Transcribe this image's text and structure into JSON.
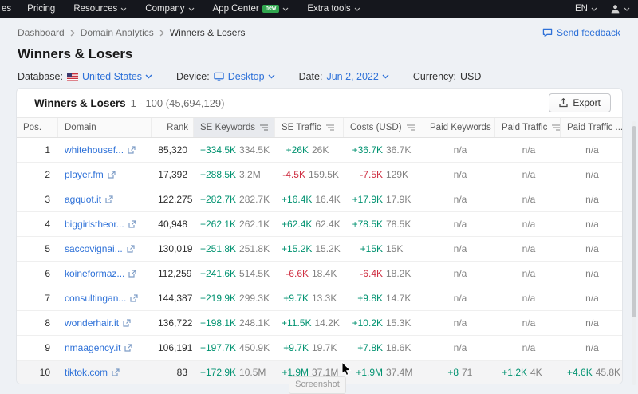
{
  "topnav": {
    "items": [
      {
        "label": "es"
      },
      {
        "label": "Pricing"
      },
      {
        "label": "Resources"
      },
      {
        "label": "Company"
      },
      {
        "label": "App Center",
        "badge": "new"
      },
      {
        "label": "Extra tools"
      }
    ],
    "lang": "EN"
  },
  "breadcrumb": {
    "items": [
      "Dashboard",
      "Domain Analytics",
      "Winners & Losers"
    ],
    "feedback_label": "Send feedback"
  },
  "page": {
    "title": "Winners & Losers"
  },
  "filters": {
    "database_label": "Database:",
    "database_value": "United States",
    "device_label": "Device:",
    "device_value": "Desktop",
    "date_label": "Date:",
    "date_value": "Jun 2, 2022",
    "currency_label": "Currency:",
    "currency_value": "USD"
  },
  "card": {
    "title": "Winners & Losers",
    "range": "1 - 100 (45,694,129)",
    "export_label": "Export"
  },
  "table": {
    "columns": [
      {
        "label": "Pos.",
        "sortable": false
      },
      {
        "label": "Domain",
        "sortable": false
      },
      {
        "label": "Rank",
        "sortable": false
      },
      {
        "label": "SE Keywords",
        "sortable": true,
        "sorted": true
      },
      {
        "label": "SE Traffic",
        "sortable": true
      },
      {
        "label": "Costs (USD)",
        "sortable": true
      },
      {
        "label": "Paid Keywords",
        "sortable": true
      },
      {
        "label": "Paid Traffic",
        "sortable": true
      },
      {
        "label": "Paid Traffic ...",
        "sortable": true
      }
    ],
    "rows": [
      {
        "pos": "1",
        "domain": "whitehousef...",
        "rank": "85,320",
        "cells": [
          {
            "delta": "+334.5K",
            "value": "334.5K",
            "dir": "up"
          },
          {
            "delta": "+26K",
            "value": "26K",
            "dir": "up"
          },
          {
            "delta": "+36.7K",
            "value": "36.7K",
            "dir": "up"
          },
          "n/a",
          "n/a",
          "n/a"
        ]
      },
      {
        "pos": "2",
        "domain": "player.fm",
        "rank": "17,392",
        "cells": [
          {
            "delta": "+288.5K",
            "value": "3.2M",
            "dir": "up"
          },
          {
            "delta": "-4.5K",
            "value": "159.5K",
            "dir": "down"
          },
          {
            "delta": "-7.5K",
            "value": "129K",
            "dir": "down"
          },
          "n/a",
          "n/a",
          "n/a"
        ]
      },
      {
        "pos": "3",
        "domain": "agquot.it",
        "rank": "122,275",
        "cells": [
          {
            "delta": "+282.7K",
            "value": "282.7K",
            "dir": "up"
          },
          {
            "delta": "+16.4K",
            "value": "16.4K",
            "dir": "up"
          },
          {
            "delta": "+17.9K",
            "value": "17.9K",
            "dir": "up"
          },
          "n/a",
          "n/a",
          "n/a"
        ]
      },
      {
        "pos": "4",
        "domain": "biggirlstheor...",
        "rank": "40,948",
        "cells": [
          {
            "delta": "+262.1K",
            "value": "262.1K",
            "dir": "up"
          },
          {
            "delta": "+62.4K",
            "value": "62.4K",
            "dir": "up"
          },
          {
            "delta": "+78.5K",
            "value": "78.5K",
            "dir": "up"
          },
          "n/a",
          "n/a",
          "n/a"
        ]
      },
      {
        "pos": "5",
        "domain": "saccovignai...",
        "rank": "130,019",
        "cells": [
          {
            "delta": "+251.8K",
            "value": "251.8K",
            "dir": "up"
          },
          {
            "delta": "+15.2K",
            "value": "15.2K",
            "dir": "up"
          },
          {
            "delta": "+15K",
            "value": "15K",
            "dir": "up"
          },
          "n/a",
          "n/a",
          "n/a"
        ]
      },
      {
        "pos": "6",
        "domain": "koineformaz...",
        "rank": "112,259",
        "cells": [
          {
            "delta": "+241.6K",
            "value": "514.5K",
            "dir": "up"
          },
          {
            "delta": "-6.6K",
            "value": "18.4K",
            "dir": "down"
          },
          {
            "delta": "-6.4K",
            "value": "18.2K",
            "dir": "down"
          },
          "n/a",
          "n/a",
          "n/a"
        ]
      },
      {
        "pos": "7",
        "domain": "consultingan...",
        "rank": "144,387",
        "cells": [
          {
            "delta": "+219.9K",
            "value": "299.3K",
            "dir": "up"
          },
          {
            "delta": "+9.7K",
            "value": "13.3K",
            "dir": "up"
          },
          {
            "delta": "+9.8K",
            "value": "14.7K",
            "dir": "up"
          },
          "n/a",
          "n/a",
          "n/a"
        ]
      },
      {
        "pos": "8",
        "domain": "wonderhair.it",
        "rank": "136,722",
        "cells": [
          {
            "delta": "+198.1K",
            "value": "248.1K",
            "dir": "up"
          },
          {
            "delta": "+11.5K",
            "value": "14.2K",
            "dir": "up"
          },
          {
            "delta": "+10.2K",
            "value": "15.3K",
            "dir": "up"
          },
          "n/a",
          "n/a",
          "n/a"
        ]
      },
      {
        "pos": "9",
        "domain": "nmaagency.it",
        "rank": "106,191",
        "cells": [
          {
            "delta": "+197.7K",
            "value": "450.9K",
            "dir": "up"
          },
          {
            "delta": "+9.7K",
            "value": "19.7K",
            "dir": "up"
          },
          {
            "delta": "+7.8K",
            "value": "18.6K",
            "dir": "up"
          },
          "n/a",
          "n/a",
          "n/a"
        ]
      },
      {
        "pos": "10",
        "domain": "tiktok.com",
        "rank": "83",
        "highlighted": true,
        "cells": [
          {
            "delta": "+172.9K",
            "value": "10.5M",
            "dir": "up"
          },
          {
            "delta": "+1.9M",
            "value": "37.1M",
            "dir": "up"
          },
          {
            "delta": "+1.9M",
            "value": "37.4M",
            "dir": "up"
          },
          {
            "delta": "+8",
            "value": "71",
            "dir": "up"
          },
          {
            "delta": "+1.2K",
            "value": "4K",
            "dir": "up"
          },
          {
            "delta": "+4.6K",
            "value": "45.8K",
            "dir": "up"
          }
        ]
      }
    ]
  },
  "tooltip": {
    "label": "Screenshot"
  },
  "colors": {
    "accent_blue": "#2e71d8",
    "positive_green": "#009270",
    "negative_red": "#cf3043",
    "navbar_bg": "#15171d",
    "badge_green": "#31a74f",
    "page_bg": "#eef1f5"
  }
}
